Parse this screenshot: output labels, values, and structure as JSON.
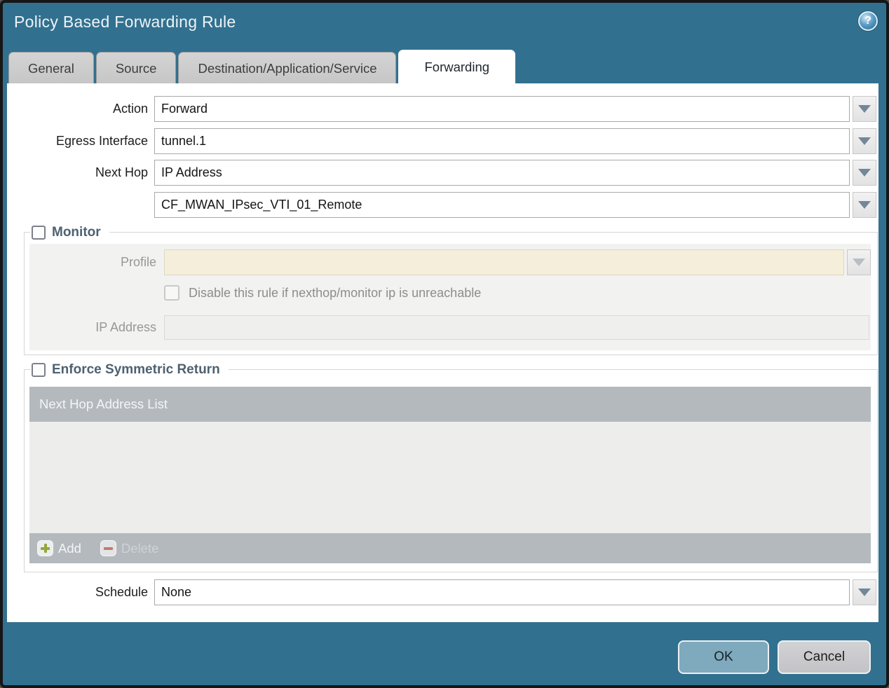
{
  "dialog": {
    "title": "Policy Based Forwarding Rule",
    "help_glyph": "?"
  },
  "tabs": [
    {
      "label": "General",
      "active": false
    },
    {
      "label": "Source",
      "active": false
    },
    {
      "label": "Destination/Application/Service",
      "active": false
    },
    {
      "label": "Forwarding",
      "active": true
    }
  ],
  "form": {
    "action": {
      "label": "Action",
      "value": "Forward"
    },
    "egress_interface": {
      "label": "Egress Interface",
      "value": "tunnel.1"
    },
    "next_hop": {
      "label": "Next Hop",
      "value": "IP Address"
    },
    "next_hop_address": {
      "value": "CF_MWAN_IPsec_VTI_01_Remote"
    },
    "schedule": {
      "label": "Schedule",
      "value": "None"
    }
  },
  "monitor": {
    "legend": "Monitor",
    "checked": false,
    "profile": {
      "label": "Profile",
      "value": ""
    },
    "disable_rule_label": "Disable this rule if nexthop/monitor ip is unreachable",
    "disable_rule_checked": false,
    "ip_address": {
      "label": "IP Address",
      "value": ""
    }
  },
  "symmetric_return": {
    "legend": "Enforce Symmetric Return",
    "checked": false,
    "list_header": "Next Hop Address List",
    "rows": [],
    "add_label": "Add",
    "delete_label": "Delete",
    "delete_enabled": false
  },
  "footer": {
    "ok_label": "OK",
    "cancel_label": "Cancel"
  },
  "colors": {
    "titlebar_teal": "#32708f",
    "ok_button": "#7fa9bd",
    "list_bar_gray": "#b4b9bd",
    "disabled_field_cream": "#f5eedb",
    "add_icon_green": "#94a83e",
    "delete_icon_red": "#c6796e"
  }
}
